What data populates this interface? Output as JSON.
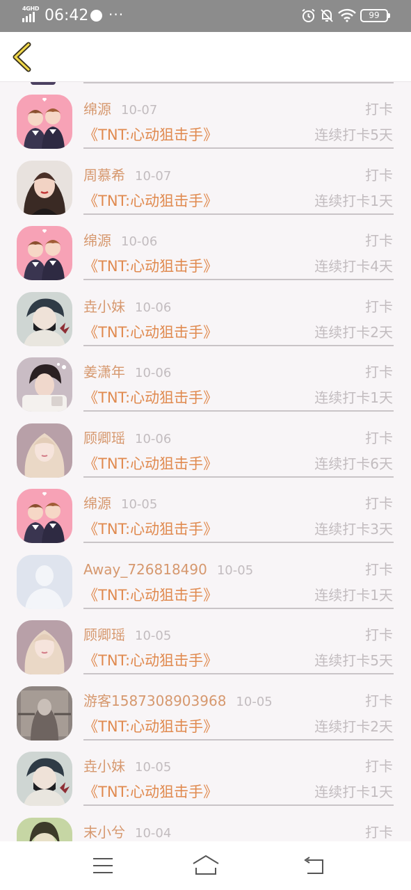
{
  "status_bar": {
    "network": "4GHD",
    "time": "06:42",
    "dots": "···",
    "battery": "99"
  },
  "header": {
    "back_icon": "chevron-left-icon"
  },
  "items": [
    {
      "name": "绵源",
      "date": "10-07",
      "action": "打卡",
      "book": "《TNT:心动狙击手》",
      "streak": "连续打卡5天",
      "avatar": "anime-couple"
    },
    {
      "name": "周慕希",
      "date": "10-07",
      "action": "打卡",
      "book": "《TNT:心动狙击手》",
      "streak": "连续打卡1天",
      "avatar": "girl-photo"
    },
    {
      "name": "绵源",
      "date": "10-06",
      "action": "打卡",
      "book": "《TNT:心动狙击手》",
      "streak": "连续打卡4天",
      "avatar": "anime-couple"
    },
    {
      "name": "垚小妹",
      "date": "10-06",
      "action": "打卡",
      "book": "《TNT:心动狙击手》",
      "streak": "连续打卡2天",
      "avatar": "anime-boy-mask"
    },
    {
      "name": "姜潇年",
      "date": "10-06",
      "action": "打卡",
      "book": "《TNT:心动狙击手》",
      "streak": "连续打卡1天",
      "avatar": "boy-photo"
    },
    {
      "name": "顾卿瑶",
      "date": "10-06",
      "action": "打卡",
      "book": "《TNT:心动狙击手》",
      "streak": "连续打卡6天",
      "avatar": "blonde-girl"
    },
    {
      "name": "绵源",
      "date": "10-05",
      "action": "打卡",
      "book": "《TNT:心动狙击手》",
      "streak": "连续打卡3天",
      "avatar": "anime-couple"
    },
    {
      "name": "Away_726818490",
      "date": "10-05",
      "action": "打卡",
      "book": "《TNT:心动狙击手》",
      "streak": "连续打卡1天",
      "avatar": "default-user"
    },
    {
      "name": "顾卿瑶",
      "date": "10-05",
      "action": "打卡",
      "book": "《TNT:心动狙击手》",
      "streak": "连续打卡5天",
      "avatar": "blonde-girl"
    },
    {
      "name": "游客1587308903968",
      "date": "10-05",
      "action": "打卡",
      "book": "《TNT:心动狙击手》",
      "streak": "连续打卡2天",
      "avatar": "sepia-photo"
    },
    {
      "name": "垚小妹",
      "date": "10-05",
      "action": "打卡",
      "book": "《TNT:心动狙击手》",
      "streak": "连续打卡1天",
      "avatar": "anime-boy-mask"
    },
    {
      "name": "末小兮",
      "date": "10-04",
      "action": "打卡",
      "book": "",
      "streak": "",
      "avatar": "green-photo"
    }
  ],
  "bottom_nav": {
    "menu_icon": "menu-icon",
    "home_icon": "home-icon",
    "back_icon": "return-icon"
  }
}
